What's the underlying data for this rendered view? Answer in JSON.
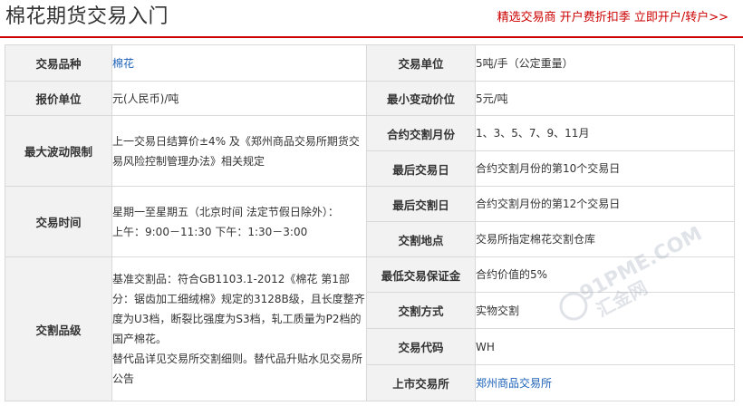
{
  "header": {
    "title": "棉花期货交易入门",
    "promo": "精选交易商 开户费折扣季 立即开户/转户>>"
  },
  "rows": {
    "r1": {
      "l_label": "交易品种",
      "l_value": "棉花",
      "r_label": "交易单位",
      "r_value": "5吨/手（公定重量）"
    },
    "r2": {
      "l_label": "报价单位",
      "l_value": "元(人民币)/吨",
      "r_label": "最小变动价位",
      "r_value": "5元/吨"
    },
    "r3": {
      "l_label": "最大波动限制",
      "l_value": "上一交易日结算价±4% 及《郑州商品交易所期货交易风险控制管理办法》相关规定",
      "r_label": "合约交割月份",
      "r_value": "1、3、5、7、9、11月"
    },
    "r4": {
      "r_label": "最后交易日",
      "r_value": "合约交割月份的第10个交易日"
    },
    "r5": {
      "l_label": "交易时间",
      "l_value_1": "星期一至星期五（北京时间 法定节假日除外）：",
      "l_value_2": "上午：9:00－11:30 下午：1:30－3:00",
      "r_label": "最后交割日",
      "r_value": "合约交割月份的第12个交易日"
    },
    "r6": {
      "r_label": "交割地点",
      "r_value": "交易所指定棉花交割仓库"
    },
    "r7": {
      "l_label": "交割品级",
      "l_value_1": "基准交割品：符合GB1103.1-2012《棉花 第1部分：锯齿加工细绒棉》规定的3128B级，且长度整齐度为U3档，断裂比强度为S3档，轧工质量为P2档的国产棉花。",
      "l_value_2": "替代品详见交易所交割细则。替代品升贴水见交易所公告",
      "r_label": "最低交易保证金",
      "r_value": "合约价值的5%"
    },
    "r8": {
      "r_label": "交割方式",
      "r_value": "实物交割"
    },
    "r9": {
      "r_label": "交易代码",
      "r_value": "WH"
    },
    "r10": {
      "r_label": "上市交易所",
      "r_value": "郑州商品交易所"
    }
  },
  "watermark": {
    "text_1": "91PME.COM",
    "text_2": "汇金网"
  }
}
